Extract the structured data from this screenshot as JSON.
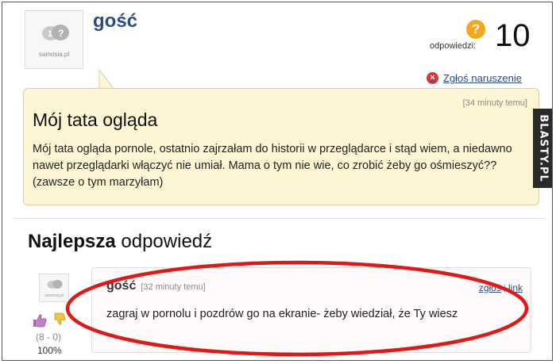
{
  "question": {
    "avatar_brand": "samosia.pl",
    "username": "gość",
    "answers_label": "odpowiedzi:",
    "answers_count": "10",
    "report_label": "Zgłoś naruszenie",
    "time": "[34 minuty temu]",
    "title": "Mój tata ogląda",
    "body": "Mój tata ogląda pornole, ostatnio zajrzałam do historii w przeglądarce i stąd wiem, a niedawno nawet przeglądarki włączyć nie umiał. Mama o tym nie wie, co zrobić żeby go ośmieszyć?? (zawsze o tym marzyłam)"
  },
  "best_answer": {
    "heading_bold": "Najlepsza",
    "heading_rest": "odpowiedź",
    "avatar_brand": "samosia.pl",
    "username": "gość",
    "time": "[32 minuty temu]",
    "link_quote": "zgłoś",
    "link_link": "link",
    "body": "zagraj w pornolu i pozdrów go na ekranie- żeby wiedział, że Ty wiesz",
    "votes": "(8 - 0)",
    "percent": "100%"
  },
  "watermark": "BLASTY.PL",
  "colors": {
    "accent": "#2b4d86",
    "question_bg": "#fdf5d4",
    "highlight_ring": "#e01818",
    "answer_icon": "#f2a81a"
  },
  "icons": [
    "avatar-placeholder-icon",
    "question-mark-icon",
    "report-icon",
    "thumb-up-icon",
    "thumb-down-icon"
  ]
}
